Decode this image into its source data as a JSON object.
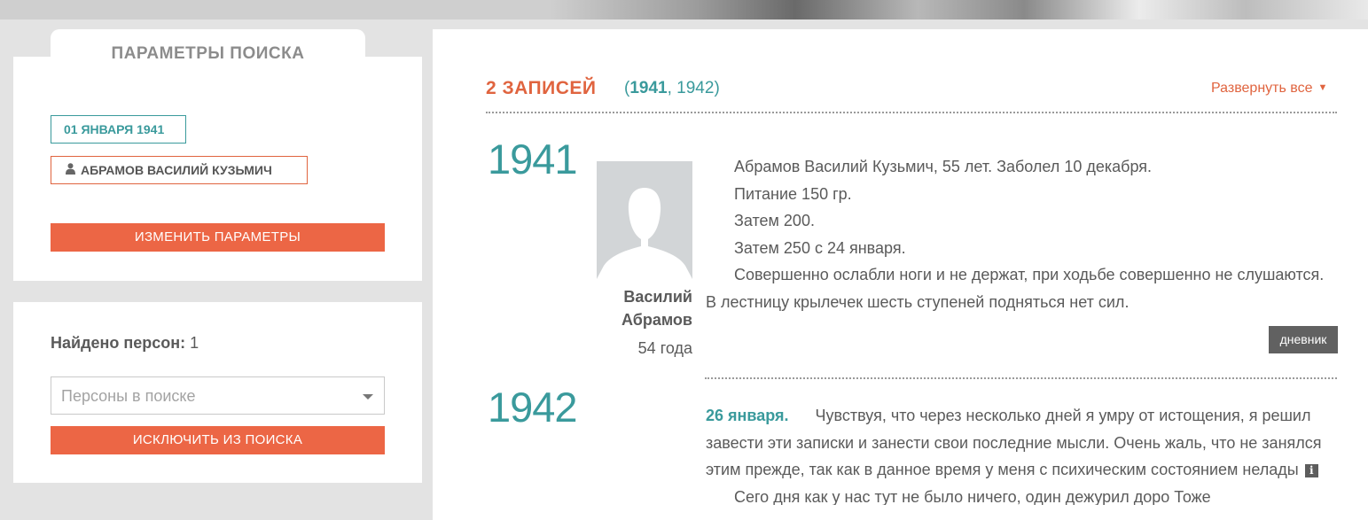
{
  "sidebar": {
    "panel_title": "ПАРАМЕТРЫ ПОИСКА",
    "date_chip": "01 ЯНВАРЯ 1941",
    "person_chip": "АБРАМОВ ВАСИЛИЙ КУЗЬМИЧ",
    "change_button": "ИЗМЕНИТЬ ПАРАМЕТРЫ",
    "found_label": "Найдено персон:",
    "found_count": "1",
    "persons_select_placeholder": "Персоны в поиске",
    "exclude_button": "ИСКЛЮЧИТЬ ИЗ ПОИСКА"
  },
  "main": {
    "records_count": "2 ЗАПИСЕЙ",
    "years_filter": {
      "open": "(",
      "year_active": "1941",
      "sep": ", ",
      "year_other": "1942",
      "close": ")"
    },
    "expand_all": "Развернуть все",
    "expand_icon": "▼",
    "entries": [
      {
        "year": "1941",
        "person_first": "Василий",
        "person_last": "Абрамов",
        "person_age": "54 года",
        "paragraphs": [
          "Абрамов Василий Кузьмич, 55 лет. Заболел 10 декабря.",
          "Питание 150 гр.",
          "Затем 200.",
          "Затем 250 с 24 января.",
          "Совершенно ослабли ноги и не держат, при ходьбе совершенно не слушаются. В лестницу крылечек шесть ступеней подняться нет сил."
        ],
        "tag": "дневник"
      },
      {
        "year": "1942",
        "date": "26 января.",
        "text": "Чувствуя, что через несколько дней я умру от истощения, я решил завести эти записки и занести свои последние мысли. Очень жаль, что не занялся этим прежде, так как в данное время у меня с психическим состоянием нелады",
        "info_icon": "i",
        "next_line_cut": "Сего дня как у нас тут не было ничего, один дежурил доро Тоже"
      }
    ]
  },
  "colors": {
    "accent_orange": "#ec6645",
    "accent_teal": "#3a9a9c",
    "tag_gray": "#616161"
  }
}
